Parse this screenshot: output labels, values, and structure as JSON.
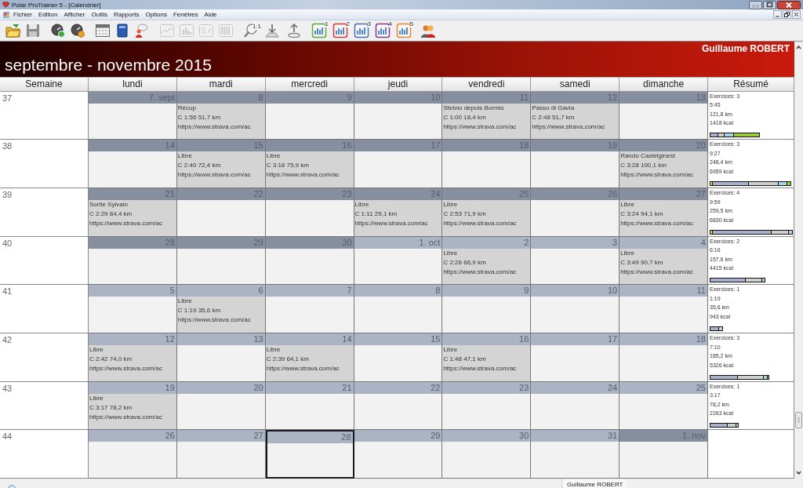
{
  "window": {
    "title": "Polar ProTrainer 5 - [Calendrier]"
  },
  "menu": [
    "Fichier",
    "Edition",
    "Afficher",
    "Outils",
    "Rapports",
    "Options",
    "Fenêtres",
    "Aide"
  ],
  "toolbar": [
    [
      {
        "kind": "folder",
        "disabled": false
      },
      {
        "kind": "save",
        "disabled": false
      }
    ],
    [
      {
        "kind": "gauge-plus",
        "disabled": false
      },
      {
        "kind": "gauge-gear",
        "disabled": false
      }
    ],
    [
      {
        "kind": "calendar",
        "disabled": false
      },
      {
        "kind": "book",
        "disabled": false
      },
      {
        "kind": "person-chat",
        "disabled": false
      }
    ],
    [
      {
        "kind": "line-chart",
        "disabled": true
      },
      {
        "kind": "bar-chart",
        "disabled": true
      },
      {
        "kind": "percent-table",
        "disabled": true
      },
      {
        "kind": "columns",
        "disabled": true
      }
    ],
    [
      {
        "kind": "magnifier",
        "label": "1:1",
        "disabled": false
      },
      {
        "kind": "download",
        "disabled": false
      },
      {
        "kind": "upload",
        "disabled": false
      }
    ],
    [
      {
        "kind": "report",
        "label": "1",
        "disabled": false
      },
      {
        "kind": "report",
        "label": "2",
        "disabled": false
      },
      {
        "kind": "report",
        "label": "3",
        "disabled": false
      },
      {
        "kind": "report",
        "label": "4",
        "disabled": false
      },
      {
        "kind": "report",
        "label": "5",
        "disabled": false
      }
    ],
    [
      {
        "kind": "people",
        "disabled": false
      }
    ]
  ],
  "banner": {
    "title": "septembre - novembre 2015",
    "user": "Guillaume ROBERT"
  },
  "columns": [
    "Semaine",
    "lundi",
    "mardi",
    "mercredi",
    "jeudi",
    "vendredi",
    "samedi",
    "dimanche",
    "Résumé"
  ],
  "weeks": [
    {
      "week": "37",
      "days": [
        {
          "date": "7. sept",
          "color": "#868fa0",
          "selected": false
        },
        {
          "date": "8",
          "color": "#868fa0",
          "selected": false,
          "activity": {
            "title": "Récup",
            "stats": "C 1:56 51,7 km",
            "link": "https://www.strava.com/ac"
          }
        },
        {
          "date": "9",
          "color": "#868fa0",
          "selected": false
        },
        {
          "date": "10",
          "color": "#868fa0",
          "selected": false
        },
        {
          "date": "11",
          "color": "#868fa0",
          "selected": false,
          "activity": {
            "title": "Stelvio depuis Bormio",
            "stats": "C 1:00 18,4 km",
            "link": "https://www.strava.com/ac"
          }
        },
        {
          "date": "12",
          "color": "#868fa0",
          "selected": false,
          "activity": {
            "title": "Passo di Gavia",
            "stats": "C 2:48 51,7 km",
            "link": "https://www.strava.com/ac"
          }
        },
        {
          "date": "13",
          "color": "#868fa0",
          "selected": false
        }
      ],
      "summary": {
        "count": "Exercices: 3",
        "duration": "5:45",
        "distance": "121,8 km",
        "energy": "1418 kcal"
      }
    },
    {
      "week": "38",
      "days": [
        {
          "date": "14",
          "color": "#868fa0",
          "selected": false
        },
        {
          "date": "15",
          "color": "#868fa0",
          "selected": false,
          "activity": {
            "title": "Libre",
            "stats": "C 2:40 72,4 km",
            "link": "https://www.strava.com/ac"
          }
        },
        {
          "date": "16",
          "color": "#868fa0",
          "selected": false,
          "activity": {
            "title": "Libre",
            "stats": "C 3:18 75,9 km",
            "link": "https://www.strava.com/ac"
          }
        },
        {
          "date": "17",
          "color": "#868fa0",
          "selected": false
        },
        {
          "date": "18",
          "color": "#868fa0",
          "selected": false
        },
        {
          "date": "19",
          "color": "#868fa0",
          "selected": false
        },
        {
          "date": "20",
          "color": "#868fa0",
          "selected": false,
          "activity": {
            "title": "Rando Castelginest",
            "stats": "C 3:28 100,1 km",
            "link": "https://www.strava.com/ac"
          }
        }
      ],
      "summary": {
        "count": "Exercices: 3",
        "duration": "9:27",
        "distance": "248,4 km",
        "energy": "6959 kcal"
      }
    },
    {
      "week": "39",
      "days": [
        {
          "date": "21",
          "color": "#868fa0",
          "selected": false,
          "activity": {
            "title": "Sortie Sylvain",
            "stats": "C 2:29 84,4 km",
            "link": "https://www.strava.com/ac"
          }
        },
        {
          "date": "22",
          "color": "#868fa0",
          "selected": false
        },
        {
          "date": "23",
          "color": "#868fa0",
          "selected": false
        },
        {
          "date": "24",
          "color": "#868fa0",
          "selected": false,
          "activity": {
            "title": "Libre",
            "stats": "C 1:11 29,1 km",
            "link": "https://www.strava.com/ac"
          }
        },
        {
          "date": "25",
          "color": "#868fa0",
          "selected": false,
          "activity": {
            "title": "Libre",
            "stats": "C 2:53 71,9 km",
            "link": "https://www.strava.com/ac"
          }
        },
        {
          "date": "26",
          "color": "#868fa0",
          "selected": false
        },
        {
          "date": "27",
          "color": "#868fa0",
          "selected": false,
          "activity": {
            "title": "Libre",
            "stats": "C 3:24 94,1 km",
            "link": "https://www.strava.com/ac"
          }
        }
      ],
      "summary": {
        "count": "Exercices: 4",
        "duration": "9:59",
        "distance": "259,5 km",
        "energy": "6830 kcal"
      }
    },
    {
      "week": "40",
      "days": [
        {
          "date": "28",
          "color": "#868fa0",
          "selected": false
        },
        {
          "date": "29",
          "color": "#868fa0",
          "selected": false
        },
        {
          "date": "30",
          "color": "#868fa0",
          "selected": false
        },
        {
          "date": "1. oct",
          "color": "#abb4c5",
          "selected": false
        },
        {
          "date": "2",
          "color": "#abb4c5",
          "selected": false,
          "activity": {
            "title": "Libre",
            "stats": "C 2:26 66,9 km",
            "link": "https://www.strava.com/ac"
          }
        },
        {
          "date": "3",
          "color": "#abb4c5",
          "selected": false
        },
        {
          "date": "4",
          "color": "#abb4c5",
          "selected": false,
          "activity": {
            "title": "Libre",
            "stats": "C 3:49 90,7 km",
            "link": "https://www.strava.com/ac"
          }
        }
      ],
      "summary": {
        "count": "Exercices: 2",
        "duration": "6:16",
        "distance": "157,6 km",
        "energy": "4415 kcal"
      }
    },
    {
      "week": "41",
      "days": [
        {
          "date": "5",
          "color": "#abb4c5",
          "selected": false
        },
        {
          "date": "6",
          "color": "#abb4c5",
          "selected": false,
          "activity": {
            "title": "Libre",
            "stats": "C 1:19 35,6 km",
            "link": "https://www.strava.com/ac"
          }
        },
        {
          "date": "7",
          "color": "#abb4c5",
          "selected": false
        },
        {
          "date": "8",
          "color": "#abb4c5",
          "selected": false
        },
        {
          "date": "9",
          "color": "#abb4c5",
          "selected": false
        },
        {
          "date": "10",
          "color": "#abb4c5",
          "selected": false
        },
        {
          "date": "11",
          "color": "#abb4c5",
          "selected": false
        }
      ],
      "summary": {
        "count": "Exercices: 1",
        "duration": "1:19",
        "distance": "35,6 km",
        "energy": "943 kcal"
      }
    },
    {
      "week": "42",
      "days": [
        {
          "date": "12",
          "color": "#abb4c5",
          "selected": false,
          "activity": {
            "title": "Libre",
            "stats": "C 2:42 74,0 km",
            "link": "https://www.strava.com/ac"
          }
        },
        {
          "date": "13",
          "color": "#abb4c5",
          "selected": false
        },
        {
          "date": "14",
          "color": "#abb4c5",
          "selected": false,
          "activity": {
            "title": "Libre",
            "stats": "C 2:39 64,1 km",
            "link": "https://www.strava.com/ac"
          }
        },
        {
          "date": "15",
          "color": "#abb4c5",
          "selected": false
        },
        {
          "date": "16",
          "color": "#abb4c5",
          "selected": false,
          "activity": {
            "title": "Libre",
            "stats": "C 1:48 47,1 km",
            "link": "https://www.strava.com/ac"
          }
        },
        {
          "date": "17",
          "color": "#abb4c5",
          "selected": false
        },
        {
          "date": "18",
          "color": "#abb4c5",
          "selected": false
        }
      ],
      "summary": {
        "count": "Exercices: 3",
        "duration": "7:10",
        "distance": "185,2 km",
        "energy": "5326 kcal"
      }
    },
    {
      "week": "43",
      "days": [
        {
          "date": "19",
          "color": "#abb4c5",
          "selected": false,
          "activity": {
            "title": "Libre",
            "stats": "C 3:17 78,2 km",
            "link": "https://www.strava.com/ac"
          }
        },
        {
          "date": "20",
          "color": "#abb4c5",
          "selected": false
        },
        {
          "date": "21",
          "color": "#abb4c5",
          "selected": false
        },
        {
          "date": "22",
          "color": "#abb4c5",
          "selected": false
        },
        {
          "date": "23",
          "color": "#abb4c5",
          "selected": false
        },
        {
          "date": "24",
          "color": "#abb4c5",
          "selected": false
        },
        {
          "date": "25",
          "color": "#abb4c5",
          "selected": false
        }
      ],
      "summary": {
        "count": "Exercices: 1",
        "duration": "3:17",
        "distance": "78,2 km",
        "energy": "2263 kcal"
      }
    },
    {
      "week": "44",
      "days": [
        {
          "date": "26",
          "color": "#abb4c5",
          "selected": false
        },
        {
          "date": "27",
          "color": "#abb4c5",
          "selected": false
        },
        {
          "date": "28",
          "color": "#abb4c5",
          "selected": true
        },
        {
          "date": "29",
          "color": "#abb4c5",
          "selected": false
        },
        {
          "date": "30",
          "color": "#abb4c5",
          "selected": false
        },
        {
          "date": "31",
          "color": "#abb4c5",
          "selected": false
        },
        {
          "date": "1. nov",
          "color": "#868fa0",
          "selected": false
        }
      ]
    }
  ],
  "status_bar": {
    "user": "Guillaume ROBERT"
  }
}
